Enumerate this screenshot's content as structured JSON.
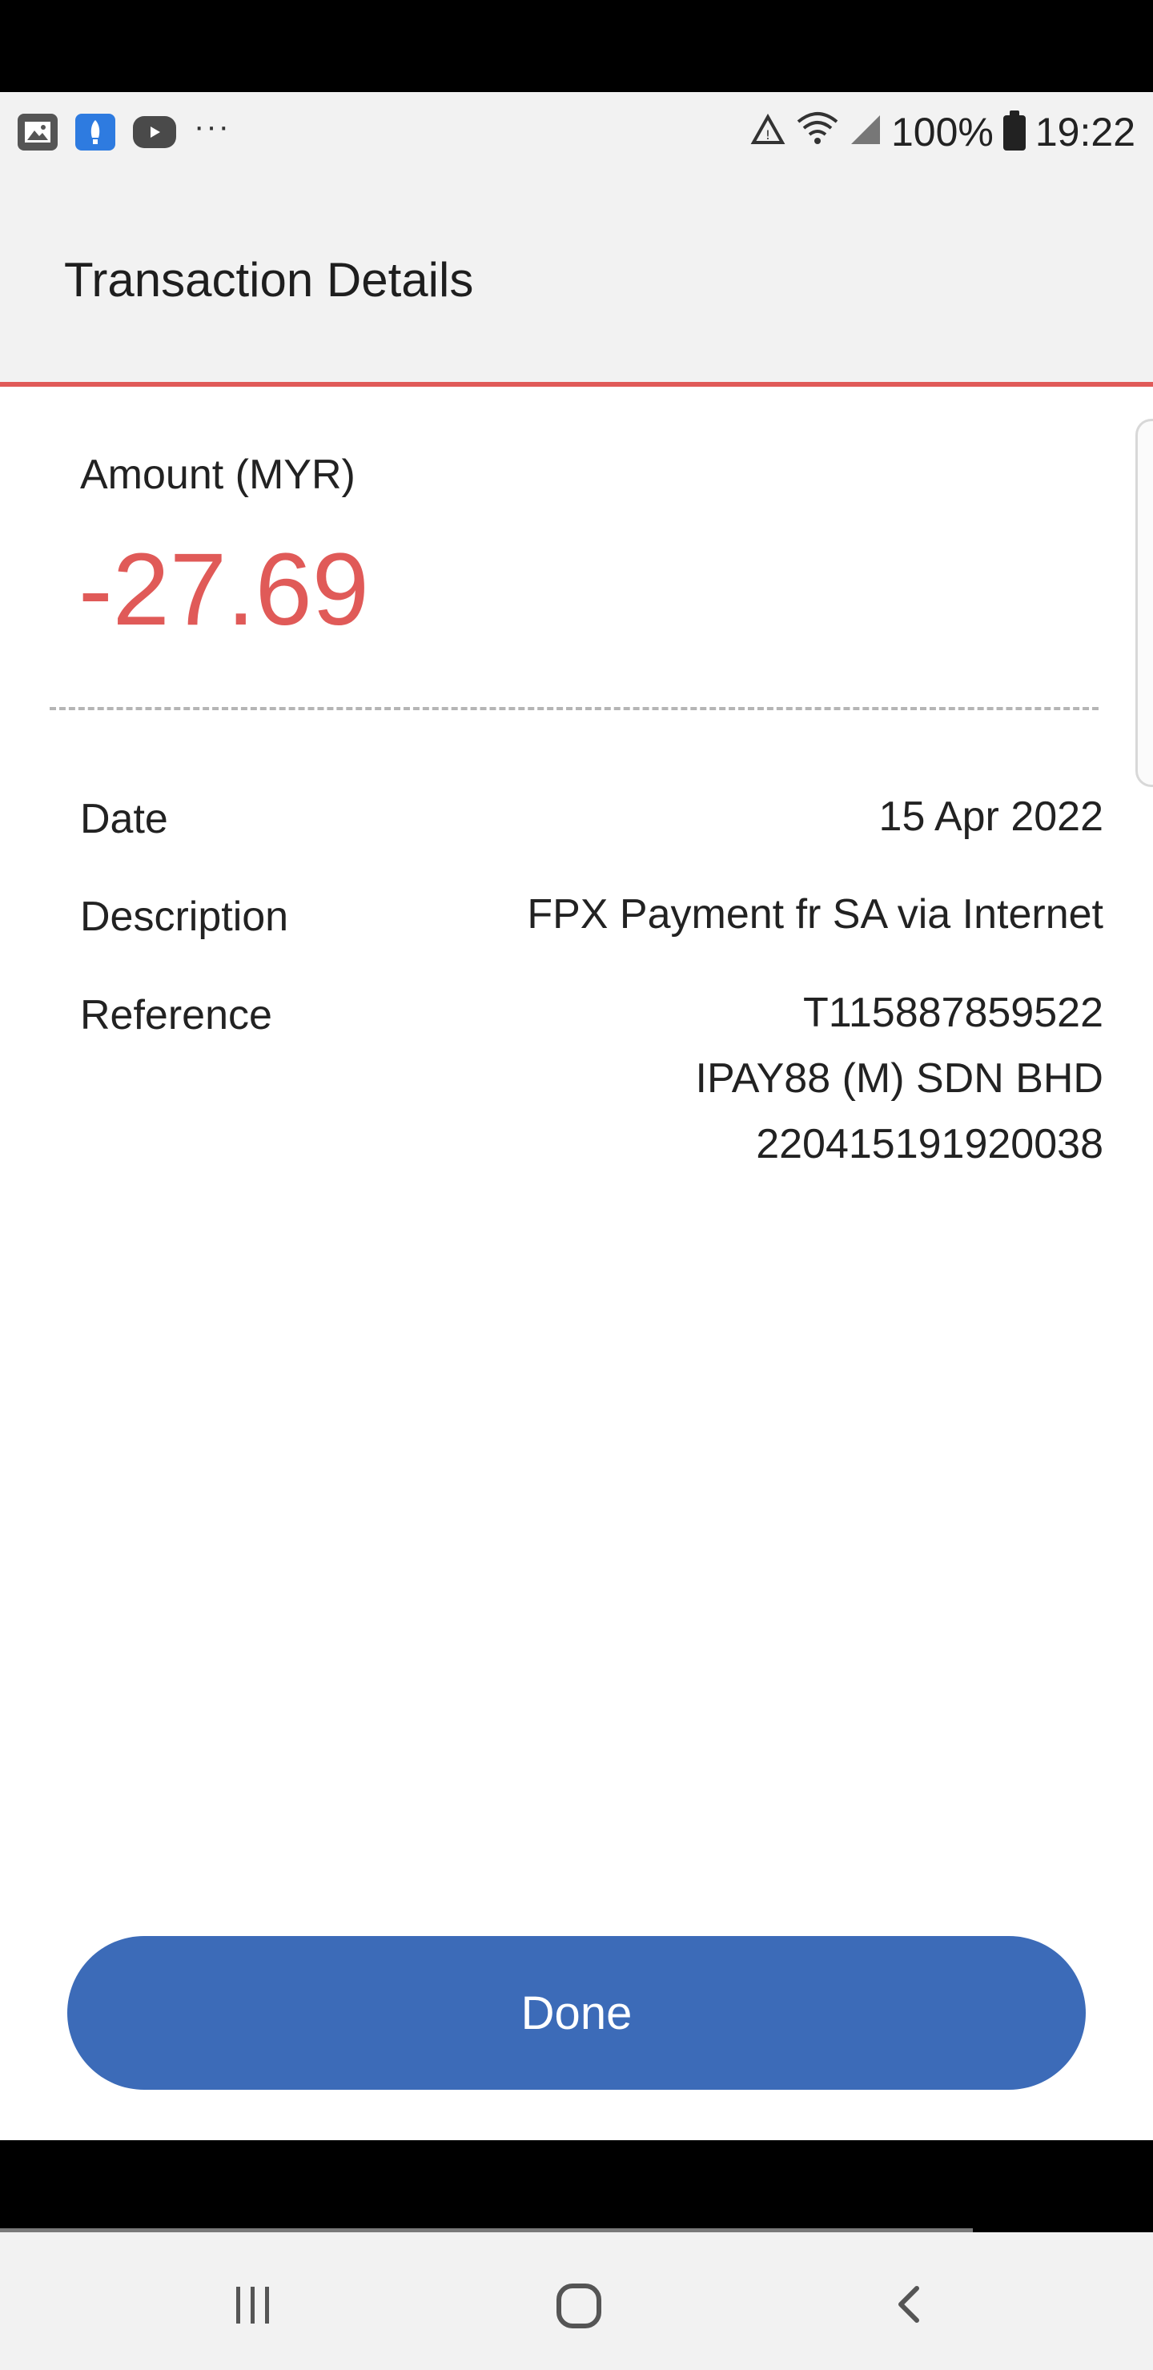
{
  "status_bar": {
    "icons_left": [
      "gallery-icon",
      "app-icon",
      "youtube-icon"
    ],
    "more": "···",
    "battery": "100%",
    "time": "19:22"
  },
  "app_bar": {
    "title": "Transaction Details"
  },
  "amount": {
    "label": "Amount (MYR)",
    "value": "-27.69",
    "color": "#e05a58"
  },
  "details": {
    "date": {
      "label": "Date",
      "value": "15 Apr 2022"
    },
    "description": {
      "label": "Description",
      "value": "FPX Payment fr SA via Internet"
    },
    "reference": {
      "label": "Reference",
      "lines": [
        "T115887859522",
        "IPAY88 (M) SDN BHD",
        "220415191920038"
      ]
    }
  },
  "done_button": {
    "label": "Done",
    "color": "#3c6bb8"
  },
  "nav_bar": {
    "icons": [
      "recent-apps-icon",
      "home-icon",
      "back-icon"
    ]
  }
}
